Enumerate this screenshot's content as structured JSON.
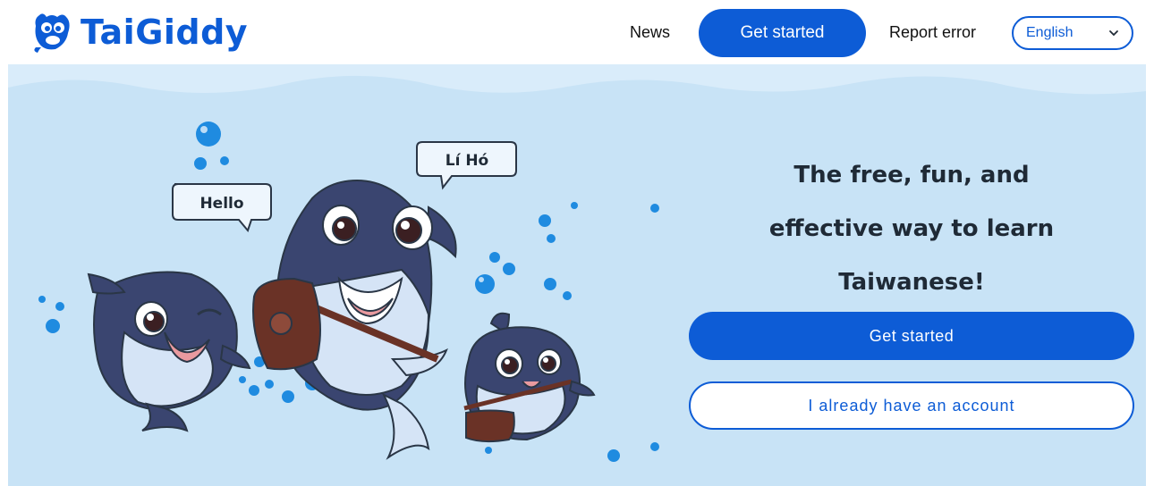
{
  "header": {
    "logo_text": "TaiGiddy",
    "nav_news": "News",
    "nav_get_started": "Get started",
    "nav_report_error": "Report error",
    "language_selected": "English"
  },
  "hero": {
    "speech_hello": "Hello",
    "speech_li_ho": "Lí Hó",
    "tagline_line1": "The free, fun, and",
    "tagline_line2": "effective way to learn",
    "tagline_line3": "Taiwanese!",
    "primary_button": "Get started",
    "secondary_button": "I already have an account"
  },
  "colors": {
    "brand_blue": "#0d5cd6",
    "hero_background": "#c8e3f6",
    "whale_navy": "#3a4570",
    "bubble_blue": "#1f8be0"
  },
  "icons": {
    "logo_mascot": "orca-mascot-icon",
    "language_chevron": "chevron-down-icon"
  }
}
